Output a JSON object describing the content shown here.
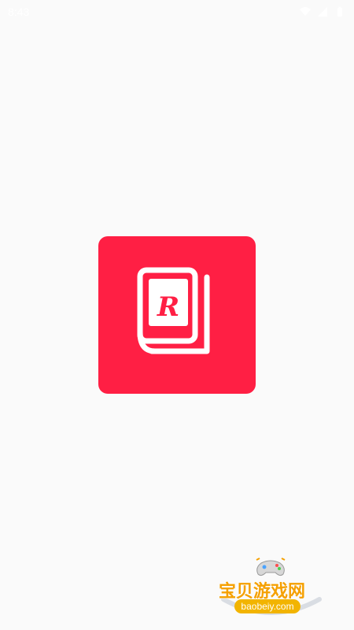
{
  "status_bar": {
    "time": "8:43",
    "icons": [
      "wifi-icon",
      "signal-icon",
      "battery-icon"
    ]
  },
  "app_icon": {
    "letter": "R",
    "icon_name": "book-icon",
    "background_color": "#ff1f44"
  },
  "watermark": {
    "title": "宝贝游戏网",
    "url": "baobeiy.com",
    "icon_name": "gamepad-icon",
    "colors": {
      "title": "#f5a000",
      "pill": "#f2b400"
    }
  }
}
